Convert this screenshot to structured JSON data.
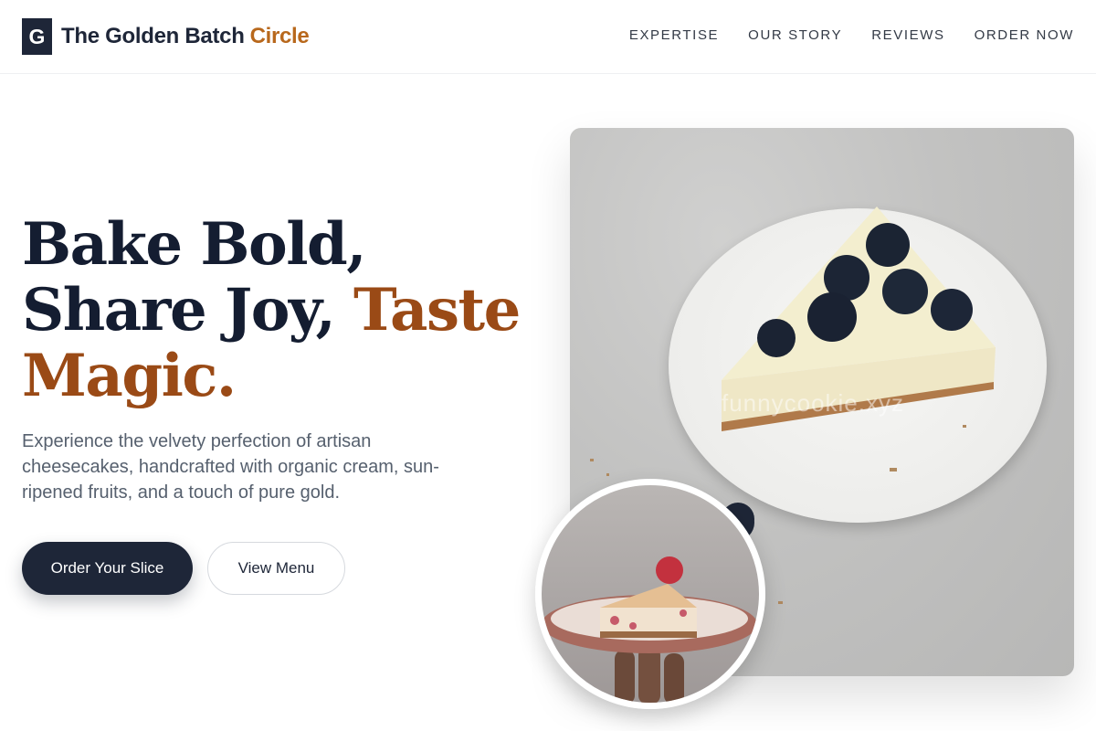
{
  "brand": {
    "mark": "G",
    "name": "The Golden Batch",
    "accent": "Circle",
    "accent_color": "#b8681c",
    "dark_color": "#1e2638"
  },
  "nav": {
    "items": [
      {
        "label": "EXPERTISE"
      },
      {
        "label": "OUR STORY"
      },
      {
        "label": "REVIEWS"
      },
      {
        "label": "ORDER NOW"
      }
    ]
  },
  "hero": {
    "line1": "Bake Bold,",
    "line2_dark": "Share Joy,",
    "line2_accent": "Taste",
    "line3_accent": "Magic.",
    "accent_color": "#9a4a16",
    "description": "Experience the velvety perfection of artisan cheesecakes, handcrafted with organic cream, sun-ripened fruits, and a touch of pure gold.",
    "primary_button": "Order Your Slice",
    "secondary_button": "View Menu"
  },
  "media": {
    "main_image": "blueberry-cheesecake-slice-on-plate",
    "watermark": "funnycookie.xyz",
    "inset_image": "berry-cheesecake-slice-held-on-plate"
  }
}
